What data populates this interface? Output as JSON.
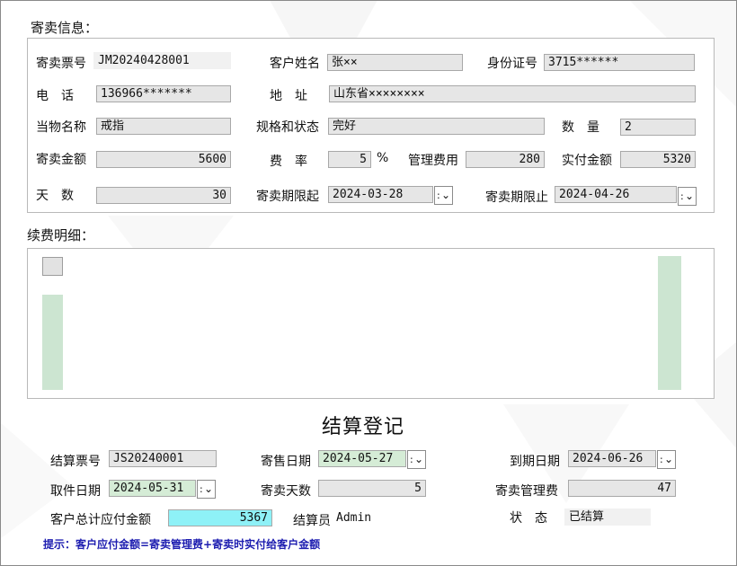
{
  "deposit": {
    "title": "寄卖信息：",
    "ticket_label": "寄卖票号",
    "ticket_value": "JM20240428001",
    "customer_label": "客户姓名",
    "customer_value": "张××",
    "id_label": "身份证号",
    "id_value": "3715******",
    "phone_label": "电　话",
    "phone_value": "136966*******",
    "address_label": "地　址",
    "address_value": "山东省××××××××",
    "item_label": "当物名称",
    "item_value": "戒指",
    "spec_label": "规格和状态",
    "spec_value": "完好",
    "qty_label": "数　量",
    "qty_value": "2",
    "amount_label": "寄卖金额",
    "amount_value": "5600",
    "rate_label": "费　率",
    "rate_value": "5",
    "rate_unit": "%",
    "mgmt_label": "管理费用",
    "mgmt_value": "280",
    "paid_label": "实付金额",
    "paid_value": "5320",
    "days_label": "天　数",
    "days_value": "30",
    "start_label": "寄卖期限起",
    "start_value": "2024-03-28",
    "end_label": "寄卖期限止",
    "end_value": "2024-04-26"
  },
  "renewal": {
    "title": "续费明细："
  },
  "settlement": {
    "title": "结算登记",
    "ticket_label": "结算票号",
    "ticket_value": "JS20240001",
    "sale_date_label": "寄售日期",
    "sale_date_value": "2024-05-27",
    "due_date_label": "到期日期",
    "due_date_value": "2024-06-26",
    "pickup_label": "取件日期",
    "pickup_value": "2024-05-31",
    "days_label": "寄卖天数",
    "days_value": "5",
    "fee_label": "寄卖管理费",
    "fee_value": "47",
    "total_label": "客户总计应付金额",
    "total_value": "5367",
    "clerk_label": "结算员",
    "clerk_value": "Admin",
    "status_label": "状　态",
    "status_value": "已结算"
  },
  "hint": "提示：客户应付金额=寄卖管理费+寄卖时实付给客户金额",
  "colors": {
    "field_bg": "#e6e6e6",
    "green_bg": "#d5ecd6",
    "cyan_bg": "#8ef1f7",
    "hint": "#1d1db0"
  },
  "icons": {
    "dropdown": "chevron-down-icon"
  }
}
